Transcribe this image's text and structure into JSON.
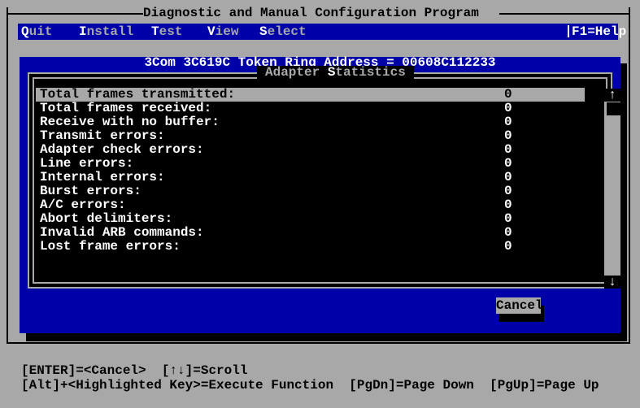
{
  "program_title": "Diagnostic and Manual Configuration Program",
  "menu": {
    "items": [
      {
        "hot": "Q",
        "rest": "uit"
      },
      {
        "hot": "I",
        "rest": "nstall"
      },
      {
        "hot": "T",
        "rest": "est"
      },
      {
        "hot": "V",
        "rest": "iew"
      },
      {
        "hot": "S",
        "rest": "elect"
      }
    ],
    "help": "F1=Help"
  },
  "dialog": {
    "title": "3Com 3C619C Token Ring Address = 00608C112233",
    "list_title_pre": "Adapter ",
    "list_title_hot": "S",
    "list_title_post": "tatistics",
    "rows": [
      {
        "label": "Total frames transmitted:",
        "value": "0"
      },
      {
        "label": "Total frames received:",
        "value": "0"
      },
      {
        "label": "Receive with no buffer:",
        "value": "0"
      },
      {
        "label": "Transmit errors:",
        "value": "0"
      },
      {
        "label": "Adapter check errors:",
        "value": "0"
      },
      {
        "label": "Line errors:",
        "value": "0"
      },
      {
        "label": "Internal errors:",
        "value": "0"
      },
      {
        "label": "Burst errors:",
        "value": "0"
      },
      {
        "label": "A/C errors:",
        "value": "0"
      },
      {
        "label": "Abort delimiters:",
        "value": "0"
      },
      {
        "label": "Invalid ARB commands:",
        "value": "0"
      },
      {
        "label": "Lost frame errors:",
        "value": "0"
      }
    ],
    "scroll_up": "↑",
    "scroll_down": "↓",
    "cancel": "Cancel"
  },
  "help_lines": [
    "[ENTER]=<Cancel>  [↑↓]=Scroll",
    "[Alt]+<Highlighted Key>=Execute Function  [PgDn]=Page Down  [PgUp]=Page Up"
  ]
}
